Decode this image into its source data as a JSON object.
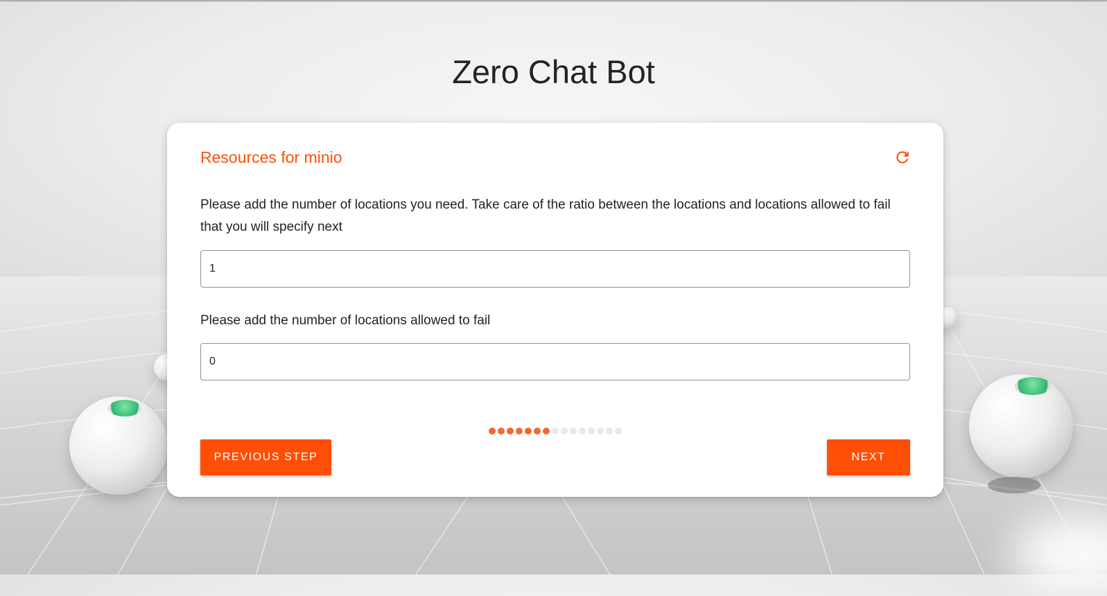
{
  "page": {
    "title": "Zero Chat Bot"
  },
  "card": {
    "title": "Resources for minio",
    "refresh_icon": "refresh-icon",
    "question_locations": "Please add the number of locations you need. Take care of the ratio between the locations and locations allowed to fail that you will specify next",
    "locations_value": "1",
    "question_fail": "Please add the number of locations allowed to fail",
    "fail_value": "0"
  },
  "progress": {
    "current_step": 7,
    "total_steps": 15
  },
  "buttons": {
    "previous_label": "PREVIOUS STEP",
    "next_label": "NEXT"
  },
  "colors": {
    "accent": "#ff4f06",
    "progress_active": "#f26a2e",
    "progress_inactive": "#e9e9e9"
  }
}
